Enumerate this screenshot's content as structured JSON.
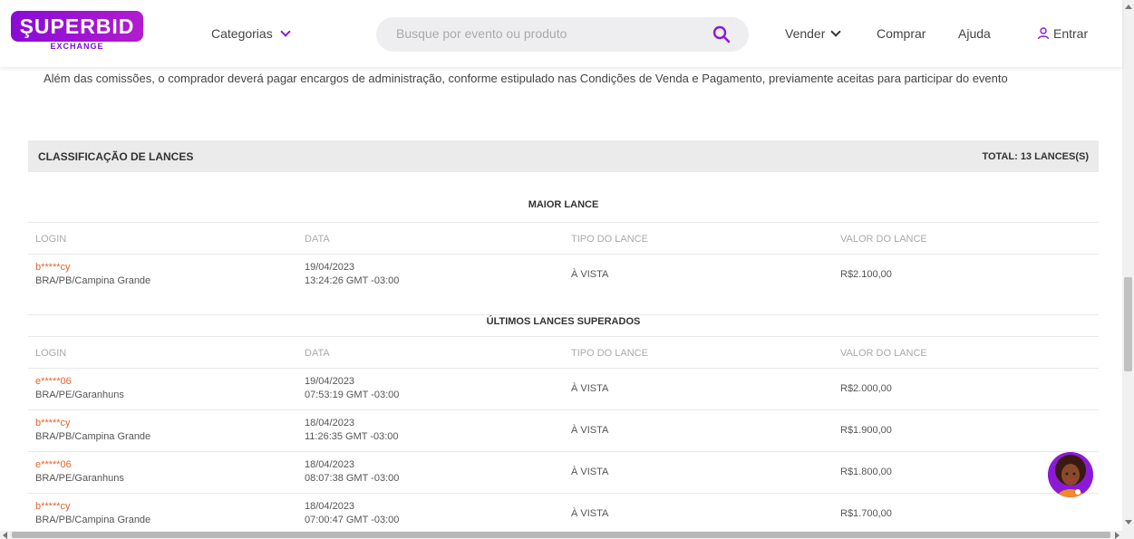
{
  "brand": {
    "name": "ŞUPERBID",
    "sub": "EXCHANGE",
    "color": "#8a0bd6"
  },
  "nav": {
    "categories": "Categorias",
    "search_placeholder": "Busque por evento ou produto",
    "sell": "Vender",
    "buy": "Comprar",
    "help": "Ajuda",
    "login": "Entrar"
  },
  "notice": "Além das comissões, o comprador deverá pagar encargos de administração, conforme estipulado nas Condições de Venda e Pagamento, previamente aceitas para participar do evento",
  "bids": {
    "title": "CLASSIFICAÇÃO DE LANCES",
    "total": "TOTAL: 13 LANCES(S)",
    "columns": [
      "LOGIN",
      "DATA",
      "TIPO DO LANCE",
      "VALOR DO LANCE"
    ],
    "highest_title": "MAIOR LANCE",
    "highest": [
      {
        "login": "b*****cy",
        "location": "BRA/PB/Campina Grande",
        "date": "19/04/2023",
        "time": "13:24:26 GMT -03:00",
        "type": "À VISTA",
        "value": "R$2.100,00"
      }
    ],
    "outbid_title": "ÚLTIMOS LANCES SUPERADOS",
    "outbid": [
      {
        "login": "e*****06",
        "location": "BRA/PE/Garanhuns",
        "date": "19/04/2023",
        "time": "07:53:19 GMT -03:00",
        "type": "À VISTA",
        "value": "R$2.000,00"
      },
      {
        "login": "b*****cy",
        "location": "BRA/PB/Campina Grande",
        "date": "18/04/2023",
        "time": "11:26:35 GMT -03:00",
        "type": "À VISTA",
        "value": "R$1.900,00"
      },
      {
        "login": "e*****06",
        "location": "BRA/PE/Garanhuns",
        "date": "18/04/2023",
        "time": "08:07:38 GMT -03:00",
        "type": "À VISTA",
        "value": "R$1.800,00"
      },
      {
        "login": "b*****cy",
        "location": "BRA/PB/Campina Grande",
        "date": "18/04/2023",
        "time": "07:00:47 GMT -03:00",
        "type": "À VISTA",
        "value": "R$1.700,00"
      }
    ]
  },
  "accent_login_color": "#e8622a"
}
